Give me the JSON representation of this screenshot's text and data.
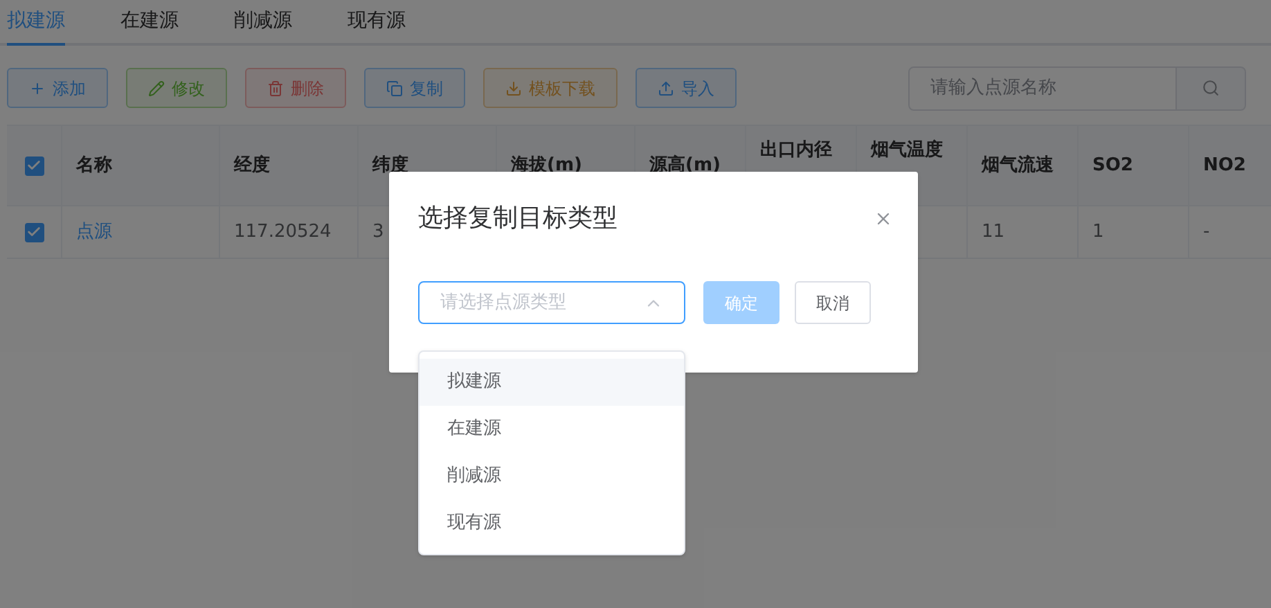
{
  "tabs": [
    {
      "label": "拟建源",
      "selected": true
    },
    {
      "label": "在建源",
      "selected": false
    },
    {
      "label": "削减源",
      "selected": false
    },
    {
      "label": "现有源",
      "selected": false
    }
  ],
  "toolbar": [
    {
      "kind": "add",
      "label": "添加"
    },
    {
      "kind": "edit",
      "label": "修改"
    },
    {
      "kind": "delete",
      "label": "删除"
    },
    {
      "kind": "copy",
      "label": "复制"
    },
    {
      "kind": "download",
      "label": "模板下载"
    },
    {
      "kind": "import",
      "label": "导入"
    }
  ],
  "search": {
    "placeholder": "请输入点源名称"
  },
  "table": {
    "all_checked": true,
    "columns": [
      "名称",
      "经度",
      "纬度",
      "海拔(m)",
      "源高(m)",
      "出口内径",
      "烟气温度",
      "烟气流速",
      "SO2",
      "NO2"
    ],
    "rows": [
      {
        "checked": true,
        "cells": [
          "点源",
          "117.20524",
          "3",
          null,
          null,
          null,
          null,
          "11",
          "1",
          "-"
        ]
      }
    ]
  },
  "dialog": {
    "title": "选择复制目标类型",
    "select": {
      "placeholder": "请选择点源类型",
      "expanded": true
    },
    "options": [
      {
        "label": "拟建源",
        "highlighted": true
      },
      {
        "label": "在建源",
        "highlighted": false
      },
      {
        "label": "削减源",
        "highlighted": false
      },
      {
        "label": "现有源",
        "highlighted": false
      }
    ],
    "confirm": {
      "label": "确定",
      "disabled": true
    },
    "cancel": {
      "label": "取消"
    }
  }
}
